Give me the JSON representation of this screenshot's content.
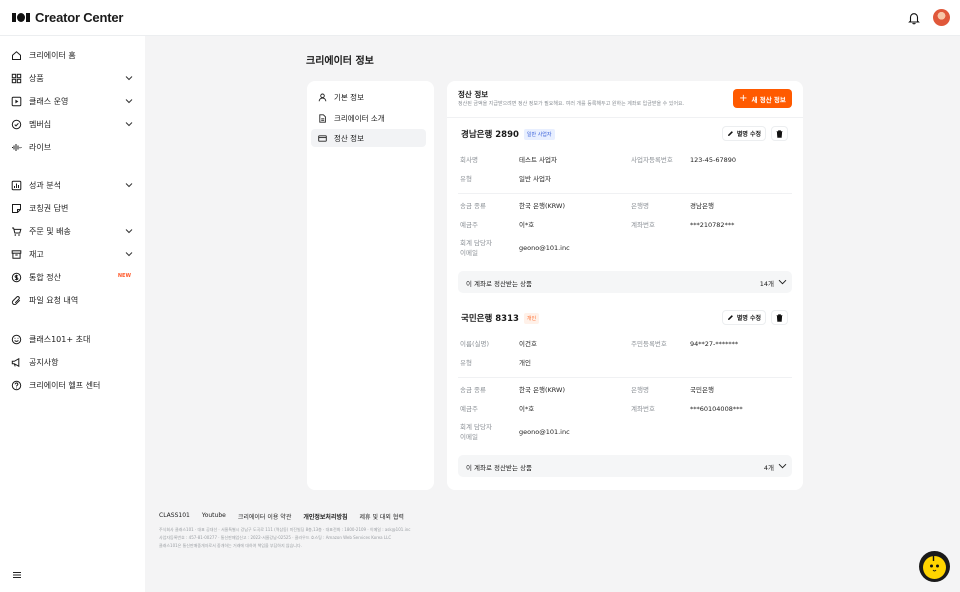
{
  "app": {
    "title": "Creator Center"
  },
  "sidebar": {
    "items": [
      {
        "label": "크리에이터 홈",
        "icon": "home-icon"
      },
      {
        "label": "상품",
        "icon": "grid-icon",
        "expand": true
      },
      {
        "label": "클래스 운영",
        "icon": "play-square-icon",
        "expand": true
      },
      {
        "label": "멤버십",
        "icon": "badge-check-icon",
        "expand": true
      },
      {
        "label": "라이브",
        "icon": "waveform-icon"
      },
      {
        "label": "성과 분석",
        "icon": "bar-chart-icon",
        "expand": true
      },
      {
        "label": "코칭권 답변",
        "icon": "note-icon"
      },
      {
        "label": "주문 및 배송",
        "icon": "cart-icon",
        "expand": true
      },
      {
        "label": "재고",
        "icon": "archive-icon",
        "expand": true
      },
      {
        "label": "통합 정산",
        "icon": "dollar-circle-icon",
        "badge": "NEW"
      },
      {
        "label": "파일 요청 내역",
        "icon": "paperclip-icon"
      },
      {
        "label": "클래스101+ 초대",
        "icon": "smile-icon"
      },
      {
        "label": "공지사항",
        "icon": "megaphone-icon"
      },
      {
        "label": "크리에이터 헬프 센터",
        "icon": "help-circle-icon"
      }
    ]
  },
  "page": {
    "title": "크리에이터 정보"
  },
  "subnav": {
    "items": [
      {
        "label": "기본 정보",
        "icon": "user-icon",
        "active": false
      },
      {
        "label": "크리에이터 소개",
        "icon": "document-icon",
        "active": false
      },
      {
        "label": "정산 정보",
        "icon": "credit-card-icon",
        "active": true
      }
    ]
  },
  "settlement": {
    "title": "정산 정보",
    "description": "정산된 금액을 지급받으려면 정산 정보가 필요해요. 여러 개를 등록해두고 원하는 계좌로 입금받을 수 있어요.",
    "add_button": "새 정산 정보",
    "accounts": [
      {
        "name": "경남은행 2890",
        "type_badge": "일반 사업자",
        "badge_style": "blue",
        "edit_label": "별명 수정",
        "rows1": [
          {
            "label": "회사명",
            "value": "테스트 사업자",
            "label2": "사업자등록번호",
            "value2": "123-45-67890"
          },
          {
            "label": "유형",
            "value": "일반 사업자"
          }
        ],
        "rows2": [
          {
            "label": "송금 종류",
            "value": "한국 은행(KRW)",
            "label2": "은행명",
            "value2": "경남은행"
          },
          {
            "label": "예금주",
            "value": "이*호",
            "label2": "계좌번호",
            "value2": "***210782***"
          }
        ],
        "email_label_1": "회계 담당자",
        "email_label_2": "이메일",
        "email": "geono@101.inc",
        "products_label": "이 계좌로 정산받는 상품",
        "products_count": "14개"
      },
      {
        "name": "국민은행 8313",
        "type_badge": "개인",
        "badge_style": "orange",
        "edit_label": "별명 수정",
        "rows1": [
          {
            "label": "이름(실명)",
            "value": "이건호",
            "label2": "주민등록번호",
            "value2": "94**27-*******"
          },
          {
            "label": "유형",
            "value": "개인"
          }
        ],
        "rows2": [
          {
            "label": "송금 종류",
            "value": "한국 은행(KRW)",
            "label2": "은행명",
            "value2": "국민은행"
          },
          {
            "label": "예금주",
            "value": "이*호",
            "label2": "계좌번호",
            "value2": "***60104008***"
          }
        ],
        "email_label_1": "회계 담당자",
        "email_label_2": "이메일",
        "email": "geono@101.inc",
        "products_label": "이 계좌로 정산받는 상품",
        "products_count": "4개"
      }
    ]
  },
  "footer": {
    "links": [
      "CLASS101",
      "Youtube",
      "크리에이터 이용 약관",
      "개인정보처리방침",
      "제휴 및 대외 협력"
    ],
    "info": [
      "주식회사 클래스101 · 대표 공대선 · 서울특별시 강남구 도곡로 111 (역삼동) 미진빌딩 8층,13층 · 대표전화 : 1800-2109 · 이메일 : ask@101.inc",
      "사업자등록번호 : 457-81-00277 · 통신판매업신고 : 2022-서울강남-02525 · 클라우드 호스팅 : Amazon Web Services Korea LLC",
      "클래스101은 통신판매중개자로서 중개하는 거래에 대하여 책임을 부담하지 않습니다."
    ]
  },
  "colors": {
    "accent": "#ff5a00",
    "badge_blue": "#3b62d9",
    "badge_orange": "#ff6a2a"
  }
}
